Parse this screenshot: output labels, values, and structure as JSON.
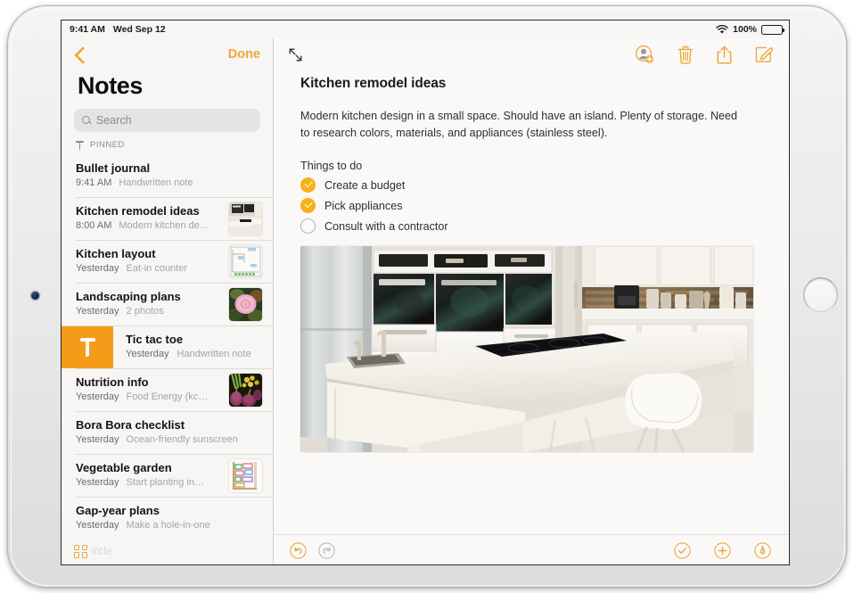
{
  "status_bar": {
    "time": "9:41 AM",
    "date": "Wed Sep 12",
    "wifi_icon": "wifi-icon",
    "battery_percent": "100%",
    "battery_icon": "battery-full-icon"
  },
  "sidebar": {
    "back_icon": "back-chevron-icon",
    "done_label": "Done",
    "title": "Notes",
    "search": {
      "placeholder": "Search",
      "value": "",
      "icon": "search-icon"
    },
    "pinned_section": {
      "icon": "pin-icon",
      "label": "PINNED"
    },
    "notes": [
      {
        "title": "Bullet journal",
        "date": "9:41 AM",
        "snippet": "Handwritten note",
        "thumbnail": false,
        "selected": false,
        "swiped": false
      },
      {
        "title": "Kitchen remodel ideas",
        "date": "8:00 AM",
        "snippet": "Modern kitchen de…",
        "thumbnail": true,
        "thumbnail_kind": "kitchen-photo",
        "selected": true,
        "swiped": false
      },
      {
        "title": "Kitchen layout",
        "date": "Yesterday",
        "snippet": "Eat-in counter",
        "thumbnail": true,
        "thumbnail_kind": "floorplan-sketch",
        "selected": false,
        "swiped": false
      },
      {
        "title": "Landscaping plans",
        "date": "Yesterday",
        "snippet": "2 photos",
        "thumbnail": true,
        "thumbnail_kind": "flower-photo",
        "selected": false,
        "swiped": false
      },
      {
        "title": "Tic tac toe",
        "date": "Yesterday",
        "snippet": "Handwritten note",
        "thumbnail": false,
        "selected": false,
        "swiped": true,
        "swipe_action_icon": "pin-icon",
        "swipe_action_color": "#f59b1a"
      },
      {
        "title": "Nutrition info",
        "date": "Yesterday",
        "snippet": "Food Energy (kc…",
        "thumbnail": true,
        "thumbnail_kind": "vegetables-photo",
        "selected": false,
        "swiped": false
      },
      {
        "title": "Bora Bora checklist",
        "date": "Yesterday",
        "snippet": "Ocean-friendly sunscreen",
        "thumbnail": false,
        "selected": false,
        "swiped": false
      },
      {
        "title": "Vegetable garden",
        "date": "Yesterday",
        "snippet": "Start planting in…",
        "thumbnail": true,
        "thumbnail_kind": "garden-plan-sketch",
        "selected": false,
        "swiped": false
      },
      {
        "title": "Gap-year plans",
        "date": "Yesterday",
        "snippet": "Make a hole-in-one",
        "thumbnail": false,
        "selected": false,
        "swiped": false
      }
    ],
    "bottom_bar": {
      "grid_icon": "folders-grid-icon",
      "faded_label": "ircle"
    }
  },
  "detail": {
    "expand_icon": "expand-arrows-icon",
    "actions": [
      {
        "icon": "add-person-icon",
        "name": "add-collaborator-button"
      },
      {
        "icon": "trash-icon",
        "name": "delete-note-button"
      },
      {
        "icon": "share-icon",
        "name": "share-note-button"
      },
      {
        "icon": "compose-icon",
        "name": "new-note-button"
      }
    ],
    "note": {
      "heading": "Kitchen remodel ideas",
      "paragraph": "Modern kitchen design in a small space. Should have an island. Plenty of storage. Need to research colors, materials, and appliances (stainless steel).",
      "todo_heading": "Things to do",
      "todos": [
        {
          "label": "Create a budget",
          "checked": true
        },
        {
          "label": "Pick appliances",
          "checked": true
        },
        {
          "label": "Consult with a contractor",
          "checked": false
        }
      ],
      "photo_alt": "Modern white kitchen with island, cooktop and stool"
    },
    "bottom_bar": {
      "undo_icon": "undo-icon",
      "redo_icon": "redo-icon",
      "checklist_icon": "checklist-icon",
      "add_icon": "add-attachment-icon",
      "markup_icon": "markup-pen-icon"
    }
  },
  "colors": {
    "accent": "#eda93b",
    "checkbox_on": "#f7b118",
    "pin_action": "#f59b1a",
    "disabled": "#bdbcb9",
    "paper": "#faf9f8",
    "sidebar": "#f7f6f4"
  }
}
